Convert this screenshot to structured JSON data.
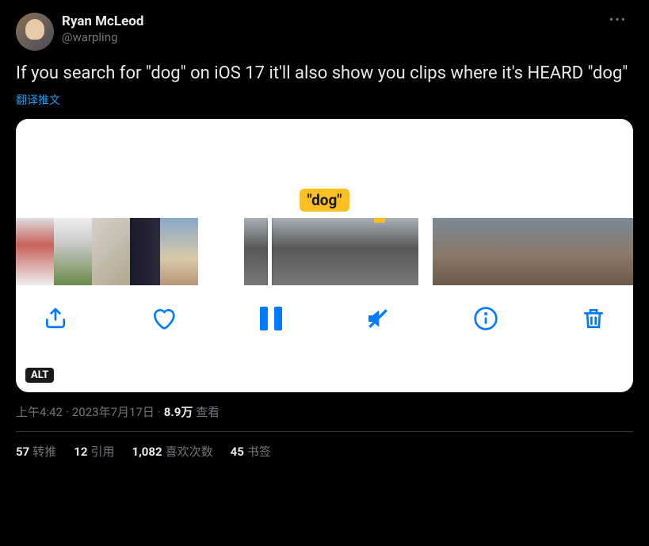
{
  "author": {
    "name": "Ryan McLeod",
    "handle": "@warpling"
  },
  "tweet_text": "If you search for \"dog\" on iOS 17 it'll also show you clips where it's HEARD \"dog\"",
  "translate_label": "翻译推文",
  "media": {
    "dog_label": "\"dog\"",
    "alt_badge": "ALT"
  },
  "meta": {
    "time": "上午4:42",
    "date": "2023年7月17日",
    "views_count": "8.9万",
    "views_label": "查看"
  },
  "stats": {
    "retweets": {
      "count": "57",
      "label": "转推"
    },
    "quotes": {
      "count": "12",
      "label": "引用"
    },
    "likes": {
      "count": "1,082",
      "label": "喜欢次数"
    },
    "bookmarks": {
      "count": "45",
      "label": "书签"
    }
  }
}
